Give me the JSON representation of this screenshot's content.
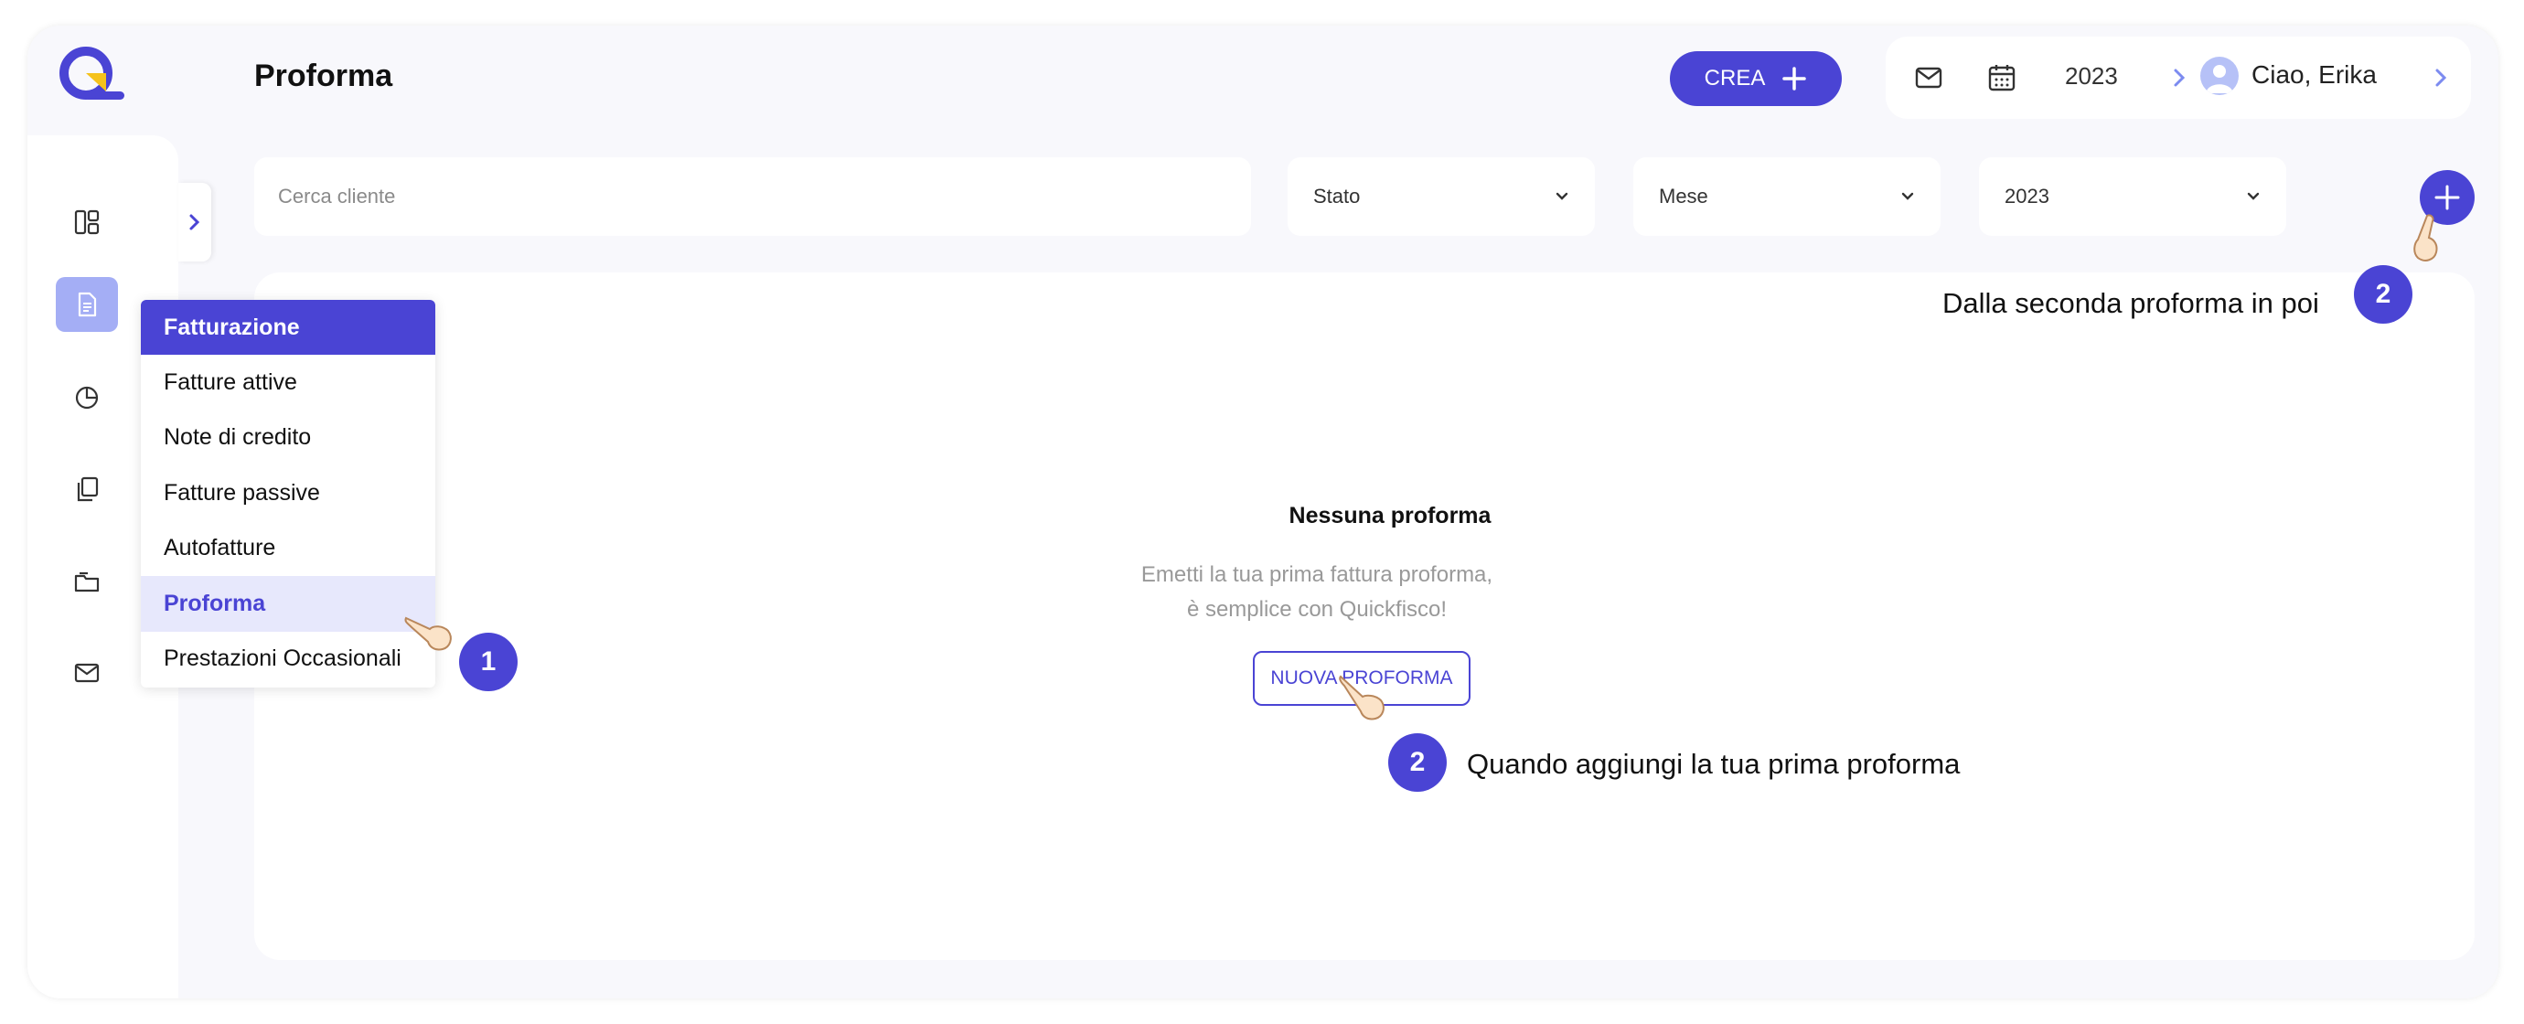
{
  "header": {
    "page_title": "Proforma",
    "create_label": "CREA",
    "year": "2023",
    "user_greeting": "Ciao, Erika"
  },
  "filters": {
    "search_placeholder": "Cerca cliente",
    "stato_value": "Stato",
    "mese_value": "Mese",
    "year_value": "2023"
  },
  "sidebar": {
    "icons": [
      "dashboard-icon",
      "document-icon",
      "pie-chart-icon",
      "copy-icon",
      "folder-icon",
      "mail-icon"
    ]
  },
  "menu": {
    "header": "Fatturazione",
    "items": [
      {
        "label": "Fatture attive"
      },
      {
        "label": "Note di credito"
      },
      {
        "label": "Fatture passive"
      },
      {
        "label": "Autofatture"
      },
      {
        "label": "Proforma"
      },
      {
        "label": "Prestazioni Occasionali"
      }
    ]
  },
  "empty_state": {
    "title": "Nessuna proforma",
    "description": "Emetti la tua prima fattura proforma, è semplice con Quickfisco!",
    "button": "NUOVA PROFORMA"
  },
  "annotations": {
    "step1_number": "1",
    "step2_top_number": "2",
    "step2_top_text": "Dalla seconda proforma in poi",
    "step2_bottom_number": "2",
    "step2_bottom_text": "Quando aggiungi la tua prima proforma"
  },
  "colors": {
    "accent": "#4a44d4",
    "sidebar_active": "#a4aef5",
    "logo_yellow": "#f5c21b"
  }
}
